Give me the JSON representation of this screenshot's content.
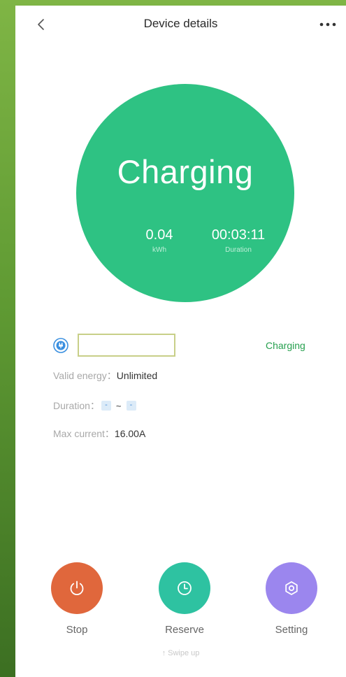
{
  "header": {
    "title": "Device details"
  },
  "status_circle": {
    "status": "Charging",
    "energy_value": "0.04",
    "energy_unit": "kWh",
    "duration_value": "00:03:11",
    "duration_label": "Duration"
  },
  "device": {
    "status": "Charging"
  },
  "info": {
    "valid_energy_label": "Valid energy：",
    "valid_energy_value": "Unlimited",
    "duration_label": "Duration：",
    "duration_start": "-",
    "duration_separator": "~",
    "duration_end": "-",
    "max_current_label": "Max current：",
    "max_current_value": "16.00A"
  },
  "actions": {
    "stop": "Stop",
    "reserve": "Reserve",
    "setting": "Setting"
  },
  "footer": {
    "swipe_hint": "↑ Swipe up"
  },
  "colors": {
    "charging_green": "#2ec283",
    "status_text_green": "#27a04f",
    "stop_orange": "#e0673c",
    "reserve_teal": "#2ec2a1",
    "setting_purple": "#9b86ee"
  },
  "icons": [
    "back-chevron-icon",
    "more-dots-icon",
    "plug-icon",
    "power-icon",
    "clock-icon",
    "gear-icon"
  ]
}
